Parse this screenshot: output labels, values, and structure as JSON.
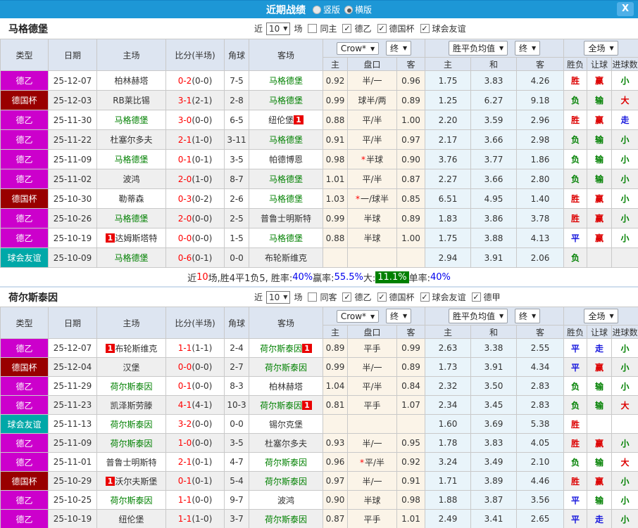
{
  "ui": {
    "dropdown_arrow": "▼",
    "check_glyph": "✓",
    "badge_text": "1"
  },
  "app": {
    "title": "近期战绩",
    "view_options": [
      {
        "label": "竖版",
        "selected": false
      },
      {
        "label": "横版",
        "selected": true
      }
    ],
    "close_label": "X"
  },
  "colors": {
    "titlebar": "#1d97d6",
    "type_badge": {
      "德乙": "#cc00cc",
      "德国杯": "#990000",
      "球会友谊": "#00a8a8"
    },
    "team_green": "#008000",
    "result": {
      "胜": "#dd0000",
      "赢": "#dd0000",
      "大": "#dd0000",
      "负": "#008000",
      "输": "#008000",
      "小": "#008000",
      "平": "#1414dd",
      "走": "#1414dd"
    }
  },
  "table_header": {
    "type": "类型",
    "date": "日期",
    "home": "主场",
    "score": "比分(半场)",
    "corner": "角球",
    "away": "客场",
    "odds_source": "Crow*",
    "odds_time": "终",
    "avg_source": "胜平负均值",
    "avg_time": "终",
    "fullmatch": "全场",
    "odds_home": "主",
    "odds_line": "盘口",
    "odds_away": "客",
    "avg_home": "主",
    "avg_draw": "和",
    "avg_away": "客",
    "result_wl": "胜负",
    "result_handicap": "让球",
    "result_goals": "进球数"
  },
  "sections": [
    {
      "team": "马格德堡",
      "filters": {
        "near": "近",
        "count": "10",
        "unit": "场",
        "same": {
          "label": "同主",
          "checked": false
        },
        "leagues": [
          {
            "label": "德乙",
            "checked": true
          },
          {
            "label": "德国杯",
            "checked": true
          },
          {
            "label": "球会友谊",
            "checked": true
          }
        ]
      },
      "rows": [
        {
          "type": "德乙",
          "date": "25-12-07",
          "home": {
            "name": "柏林赫塔",
            "green": false,
            "badge": null
          },
          "score": "0-2",
          "half": "(0-0)",
          "corner": "7-5",
          "away": {
            "name": "马格德堡",
            "green": true,
            "badge": null
          },
          "odds": [
            "0.92",
            "半/一",
            "0.96"
          ],
          "odds_star": false,
          "avg": [
            "1.75",
            "3.83",
            "4.26"
          ],
          "results": [
            "胜",
            "赢",
            "小"
          ]
        },
        {
          "type": "德国杯",
          "date": "25-12-03",
          "home": {
            "name": "RB莱比锡",
            "green": false,
            "badge": null
          },
          "score": "3-1",
          "half": "(2-1)",
          "corner": "2-8",
          "away": {
            "name": "马格德堡",
            "green": true,
            "badge": null
          },
          "odds": [
            "0.99",
            "球半/两",
            "0.89"
          ],
          "odds_star": false,
          "avg": [
            "1.25",
            "6.27",
            "9.18"
          ],
          "results": [
            "负",
            "输",
            "大"
          ]
        },
        {
          "type": "德乙",
          "date": "25-11-30",
          "home": {
            "name": "马格德堡",
            "green": true,
            "badge": null
          },
          "score": "3-0",
          "half": "(0-0)",
          "corner": "6-5",
          "away": {
            "name": "纽伦堡",
            "green": false,
            "badge": "after"
          },
          "odds": [
            "0.88",
            "平/半",
            "1.00"
          ],
          "odds_star": false,
          "avg": [
            "2.20",
            "3.59",
            "2.96"
          ],
          "results": [
            "胜",
            "赢",
            "走"
          ]
        },
        {
          "type": "德乙",
          "date": "25-11-22",
          "home": {
            "name": "杜塞尔多夫",
            "green": false,
            "badge": null
          },
          "score": "2-1",
          "half": "(1-0)",
          "corner": "3-11",
          "away": {
            "name": "马格德堡",
            "green": true,
            "badge": null
          },
          "odds": [
            "0.91",
            "平/半",
            "0.97"
          ],
          "odds_star": false,
          "avg": [
            "2.17",
            "3.66",
            "2.98"
          ],
          "results": [
            "负",
            "输",
            "小"
          ]
        },
        {
          "type": "德乙",
          "date": "25-11-09",
          "home": {
            "name": "马格德堡",
            "green": true,
            "badge": null
          },
          "score": "0-1",
          "half": "(0-1)",
          "corner": "3-5",
          "away": {
            "name": "帕德博恩",
            "green": false,
            "badge": null
          },
          "odds": [
            "0.98",
            "半球",
            "0.90"
          ],
          "odds_star": true,
          "avg": [
            "3.76",
            "3.77",
            "1.86"
          ],
          "results": [
            "负",
            "输",
            "小"
          ]
        },
        {
          "type": "德乙",
          "date": "25-11-02",
          "home": {
            "name": "波鸿",
            "green": false,
            "badge": null
          },
          "score": "2-0",
          "half": "(1-0)",
          "corner": "8-7",
          "away": {
            "name": "马格德堡",
            "green": true,
            "badge": null
          },
          "odds": [
            "1.01",
            "平/半",
            "0.87"
          ],
          "odds_star": false,
          "avg": [
            "2.27",
            "3.66",
            "2.80"
          ],
          "results": [
            "负",
            "输",
            "小"
          ]
        },
        {
          "type": "德国杯",
          "date": "25-10-30",
          "home": {
            "name": "勒蒂森",
            "green": false,
            "badge": null
          },
          "score": "0-3",
          "half": "(0-2)",
          "corner": "2-6",
          "away": {
            "name": "马格德堡",
            "green": true,
            "badge": null
          },
          "odds": [
            "1.03",
            "一/球半",
            "0.85"
          ],
          "odds_star": true,
          "avg": [
            "6.51",
            "4.95",
            "1.40"
          ],
          "results": [
            "胜",
            "赢",
            "小"
          ]
        },
        {
          "type": "德乙",
          "date": "25-10-26",
          "home": {
            "name": "马格德堡",
            "green": true,
            "badge": null
          },
          "score": "2-0",
          "half": "(0-0)",
          "corner": "2-5",
          "away": {
            "name": "普鲁士明斯特",
            "green": false,
            "badge": null
          },
          "odds": [
            "0.99",
            "半球",
            "0.89"
          ],
          "odds_star": false,
          "avg": [
            "1.83",
            "3.86",
            "3.78"
          ],
          "results": [
            "胜",
            "赢",
            "小"
          ]
        },
        {
          "type": "德乙",
          "date": "25-10-19",
          "home": {
            "name": "达姆斯塔特",
            "green": false,
            "badge": "before"
          },
          "score": "0-0",
          "half": "(0-0)",
          "corner": "1-5",
          "away": {
            "name": "马格德堡",
            "green": true,
            "badge": null
          },
          "odds": [
            "0.88",
            "半球",
            "1.00"
          ],
          "odds_star": false,
          "avg": [
            "1.75",
            "3.88",
            "4.13"
          ],
          "results": [
            "平",
            "赢",
            "小"
          ]
        },
        {
          "type": "球会友谊",
          "date": "25-10-09",
          "home": {
            "name": "马格德堡",
            "green": true,
            "badge": null
          },
          "score": "0-6",
          "half": "(0-1)",
          "corner": "0-0",
          "away": {
            "name": "布轮斯维克",
            "green": false,
            "badge": null
          },
          "odds": [
            "",
            "",
            ""
          ],
          "odds_star": false,
          "avg": [
            "2.94",
            "3.91",
            "2.06"
          ],
          "results": [
            "负",
            "",
            ""
          ]
        }
      ],
      "summary_parts": [
        {
          "t": "近",
          "c": "#333333"
        },
        {
          "t": "10",
          "c": "#ff0000"
        },
        {
          "t": "场,胜4平1负5, 胜率:",
          "c": "#333333"
        },
        {
          "t": "40%",
          "c": "#0000ee"
        },
        {
          "t": " 赢率:",
          "c": "#333333"
        },
        {
          "t": "55.5%",
          "c": "#0000ee"
        },
        {
          "t": " 大:",
          "c": "#333333"
        },
        {
          "t": "11.1%",
          "c": "#ffffff",
          "bg": "#008000"
        },
        {
          "t": " 单率:",
          "c": "#333333"
        },
        {
          "t": "40%",
          "c": "#0000ee"
        }
      ]
    },
    {
      "team": "荷尔斯泰因",
      "filters": {
        "near": "近",
        "count": "10",
        "unit": "场",
        "same": {
          "label": "同客",
          "checked": false
        },
        "leagues": [
          {
            "label": "德乙",
            "checked": true
          },
          {
            "label": "德国杯",
            "checked": true
          },
          {
            "label": "球会友谊",
            "checked": true
          },
          {
            "label": "德甲",
            "checked": true
          }
        ]
      },
      "rows": [
        {
          "type": "德乙",
          "date": "25-12-07",
          "home": {
            "name": "布轮斯维克",
            "green": false,
            "badge": "before"
          },
          "score": "1-1",
          "half": "(1-1)",
          "corner": "2-4",
          "away": {
            "name": "荷尔斯泰因",
            "green": true,
            "badge": "after"
          },
          "odds": [
            "0.89",
            "平手",
            "0.99"
          ],
          "odds_star": false,
          "avg": [
            "2.63",
            "3.38",
            "2.55"
          ],
          "results": [
            "平",
            "走",
            "小"
          ]
        },
        {
          "type": "德国杯",
          "date": "25-12-04",
          "home": {
            "name": "汉堡",
            "green": false,
            "badge": null
          },
          "score": "0-0",
          "half": "(0-0)",
          "corner": "2-7",
          "away": {
            "name": "荷尔斯泰因",
            "green": true,
            "badge": null
          },
          "odds": [
            "0.99",
            "半/一",
            "0.89"
          ],
          "odds_star": false,
          "avg": [
            "1.73",
            "3.91",
            "4.34"
          ],
          "results": [
            "平",
            "赢",
            "小"
          ]
        },
        {
          "type": "德乙",
          "date": "25-11-29",
          "home": {
            "name": "荷尔斯泰因",
            "green": true,
            "badge": null
          },
          "score": "0-1",
          "half": "(0-0)",
          "corner": "8-3",
          "away": {
            "name": "柏林赫塔",
            "green": false,
            "badge": null
          },
          "odds": [
            "1.04",
            "平/半",
            "0.84"
          ],
          "odds_star": false,
          "avg": [
            "2.32",
            "3.50",
            "2.83"
          ],
          "results": [
            "负",
            "输",
            "小"
          ]
        },
        {
          "type": "德乙",
          "date": "25-11-23",
          "home": {
            "name": "凯泽斯劳滕",
            "green": false,
            "badge": null
          },
          "score": "4-1",
          "half": "(4-1)",
          "corner": "10-3",
          "away": {
            "name": "荷尔斯泰因",
            "green": true,
            "badge": "after"
          },
          "odds": [
            "0.81",
            "平手",
            "1.07"
          ],
          "odds_star": false,
          "avg": [
            "2.34",
            "3.45",
            "2.83"
          ],
          "results": [
            "负",
            "输",
            "大"
          ]
        },
        {
          "type": "球会友谊",
          "date": "25-11-13",
          "home": {
            "name": "荷尔斯泰因",
            "green": true,
            "badge": null
          },
          "score": "3-2",
          "half": "(0-0)",
          "corner": "0-0",
          "away": {
            "name": "锡尔克堡",
            "green": false,
            "badge": null
          },
          "odds": [
            "",
            "",
            ""
          ],
          "odds_star": false,
          "avg": [
            "1.60",
            "3.69",
            "5.38"
          ],
          "results": [
            "胜",
            "",
            ""
          ]
        },
        {
          "type": "德乙",
          "date": "25-11-09",
          "home": {
            "name": "荷尔斯泰因",
            "green": true,
            "badge": null
          },
          "score": "1-0",
          "half": "(0-0)",
          "corner": "3-5",
          "away": {
            "name": "杜塞尔多夫",
            "green": false,
            "badge": null
          },
          "odds": [
            "0.93",
            "半/一",
            "0.95"
          ],
          "odds_star": false,
          "avg": [
            "1.78",
            "3.83",
            "4.05"
          ],
          "results": [
            "胜",
            "赢",
            "小"
          ]
        },
        {
          "type": "德乙",
          "date": "25-11-01",
          "home": {
            "name": "普鲁士明斯特",
            "green": false,
            "badge": null
          },
          "score": "2-1",
          "half": "(0-1)",
          "corner": "4-7",
          "away": {
            "name": "荷尔斯泰因",
            "green": true,
            "badge": null
          },
          "odds": [
            "0.96",
            "平/半",
            "0.92"
          ],
          "odds_star": true,
          "avg": [
            "3.24",
            "3.49",
            "2.10"
          ],
          "results": [
            "负",
            "输",
            "大"
          ]
        },
        {
          "type": "德国杯",
          "date": "25-10-29",
          "home": {
            "name": "沃尔夫斯堡",
            "green": false,
            "badge": "before"
          },
          "score": "0-1",
          "half": "(0-1)",
          "corner": "5-4",
          "away": {
            "name": "荷尔斯泰因",
            "green": true,
            "badge": null
          },
          "odds": [
            "0.97",
            "半/一",
            "0.91"
          ],
          "odds_star": false,
          "avg": [
            "1.71",
            "3.89",
            "4.46"
          ],
          "results": [
            "胜",
            "赢",
            "小"
          ]
        },
        {
          "type": "德乙",
          "date": "25-10-25",
          "home": {
            "name": "荷尔斯泰因",
            "green": true,
            "badge": null
          },
          "score": "1-1",
          "half": "(0-0)",
          "corner": "9-7",
          "away": {
            "name": "波鸿",
            "green": false,
            "badge": null
          },
          "odds": [
            "0.90",
            "半球",
            "0.98"
          ],
          "odds_star": false,
          "avg": [
            "1.88",
            "3.87",
            "3.56"
          ],
          "results": [
            "平",
            "输",
            "小"
          ]
        },
        {
          "type": "德乙",
          "date": "25-10-19",
          "home": {
            "name": "纽伦堡",
            "green": false,
            "badge": null
          },
          "score": "1-1",
          "half": "(1-0)",
          "corner": "3-7",
          "away": {
            "name": "荷尔斯泰因",
            "green": true,
            "badge": null
          },
          "odds": [
            "0.87",
            "平手",
            "1.01"
          ],
          "odds_star": false,
          "avg": [
            "2.49",
            "3.41",
            "2.65"
          ],
          "results": [
            "平",
            "走",
            "小"
          ]
        }
      ],
      "summary_parts": null
    }
  ]
}
